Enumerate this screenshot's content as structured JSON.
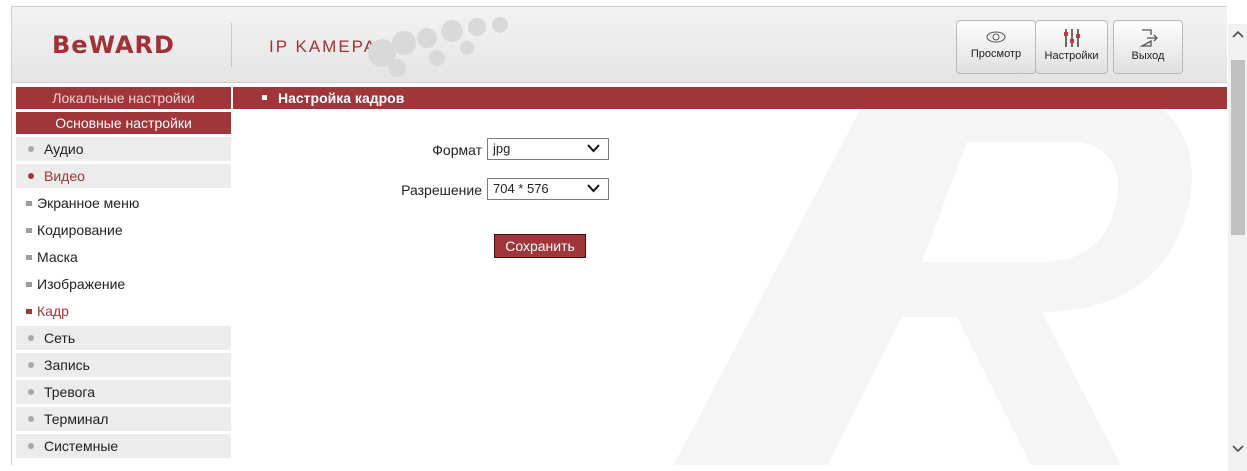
{
  "header": {
    "logo": "BeWARD",
    "product": "IP KAMEPA",
    "buttons": [
      {
        "label": "Просмотр",
        "icon": "eye-icon"
      },
      {
        "label": "Настройки",
        "icon": "sliders-icon"
      },
      {
        "label": "Выход",
        "icon": "exit-icon"
      }
    ]
  },
  "sidebar": {
    "local_settings": "Локальные настройки",
    "main_settings": "Основные настройки",
    "audio": "Аудио",
    "video": "Видео",
    "video_sub": [
      "Экранное меню",
      "Кодирование",
      "Маска",
      "Изображение",
      "Кадр"
    ],
    "network": "Сеть",
    "record": "Запись",
    "alarm": "Тревога",
    "terminal": "Терминал",
    "system": "Системные"
  },
  "content": {
    "title": "Настройка кадров",
    "format_label": "Формат",
    "format_value": "jpg",
    "resolution_label": "Разрешение",
    "resolution_value": "704 * 576",
    "save_label": "Сохранить"
  },
  "colors": {
    "accent": "#a0353a",
    "sidebar_item_bg": "#ececec",
    "header_bg": "#eaeaea"
  }
}
